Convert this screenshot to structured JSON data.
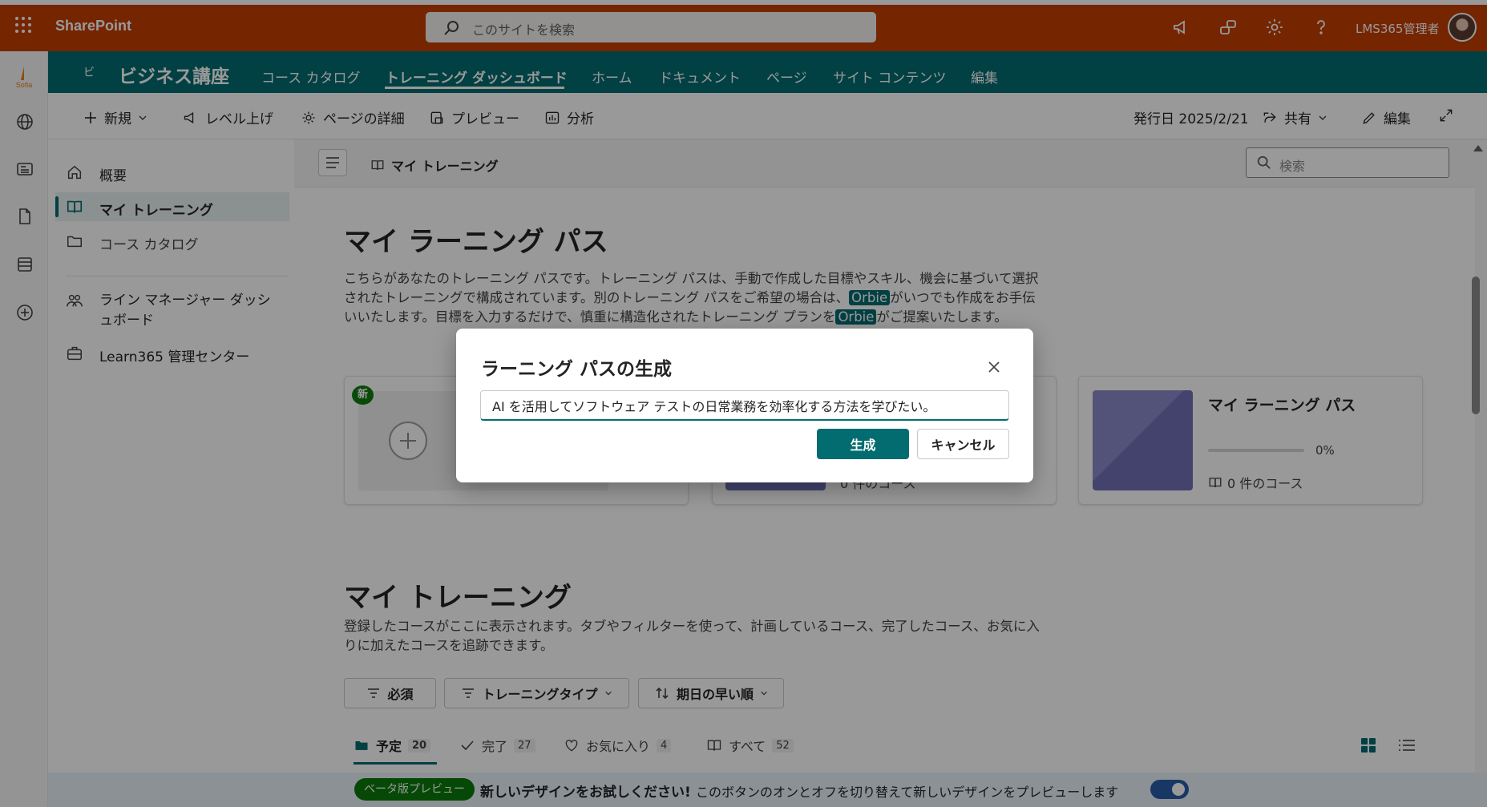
{
  "app": {
    "brand": "SharePoint",
    "search_placeholder": "このサイトを検索",
    "admin_name": "LMS365管理者",
    "icons": [
      "waffle-icon",
      "search-icon",
      "megaphone-icon",
      "chat-icon",
      "gear-icon",
      "help-icon"
    ]
  },
  "rail": {
    "logo_text": "Sofia",
    "icons": [
      "globe-icon",
      "news-icon",
      "document-icon",
      "list-icon",
      "add-icon"
    ]
  },
  "site": {
    "logo_text": "ビ",
    "title": "ビジネス講座",
    "nav": [
      {
        "label": "コース カタログ",
        "active": false
      },
      {
        "label": "トレーニング ダッシュボード",
        "active": true
      },
      {
        "label": "ホーム",
        "active": false
      },
      {
        "label": "ドキュメント",
        "active": false
      },
      {
        "label": "ページ",
        "active": false
      },
      {
        "label": "サイト コンテンツ",
        "active": false
      },
      {
        "label": "編集",
        "active": false
      }
    ],
    "accent_color": "#036c70"
  },
  "commandbar": {
    "new": "新規",
    "promote": "レベル上げ",
    "page_details": "ページの詳細",
    "preview": "プレビュー",
    "analytics": "分析",
    "published": "発行日 2025/2/21",
    "share": "共有",
    "edit": "編集"
  },
  "leftnav": {
    "items": [
      {
        "label": "概要",
        "icon": "home-icon"
      },
      {
        "label": "マイ トレーニング",
        "icon": "book-icon",
        "active": true
      },
      {
        "label": "コース カタログ",
        "icon": "folder-icon"
      },
      {
        "label": "ライン マネージャー ダッシュボード",
        "icon": "people-icon"
      },
      {
        "label": "Learn365 管理センター",
        "icon": "briefcase-icon"
      }
    ]
  },
  "content": {
    "breadcrumb": "マイ トレーニング",
    "search_placeholder": "検索",
    "learning_path": {
      "title": "マイ ラーニング パス",
      "desc_1": "こちらがあなたのトレーニング パスです。トレーニング パスは、手動で作成した目標やスキル、機会に基づいて選択されたトレーニングで構成されています。別のトレーニング パスをご希望の場合は、",
      "orbie": "Orbie",
      "desc_2": "がいつでも作成をお手伝いいたします。目標を入力するだけで、慎重に構造化されたトレーニング プランを",
      "desc_3": "がご提案いたします。",
      "new_badge": "新",
      "card3_title": "マイ ラーニング パス",
      "card3_progress": "0%",
      "card3_progress_value": 0,
      "card3_courses": "0 件のコース",
      "card2_courses": "0 件のコース"
    },
    "my_training": {
      "title": "マイ トレーニング",
      "desc": "登録したコースがここに表示されます。タブやフィルターを使って、計画しているコース、完了したコース、お気に入りに加えたコースを追跡できます。",
      "filters": [
        "必須",
        "トレーニングタイプ",
        "期日の早い順"
      ],
      "tabs": [
        {
          "label": "予定",
          "count": "20",
          "active": true
        },
        {
          "label": "完了",
          "count": "27"
        },
        {
          "label": "お気に入り",
          "count": "4"
        },
        {
          "label": "すべて",
          "count": "52"
        }
      ]
    }
  },
  "beta": {
    "pill": "ベータ版プレビュー",
    "strong": "新しいデザインをお試しください!",
    "text": "このボタンのオンとオフを切り替えて新しいデザインをプレビューします",
    "toggle_on": true
  },
  "dialog": {
    "title": "ラーニング パスの生成",
    "input_value": "AI を活用してソフトウェア テストの日常業務を効率化する方法を学びたい。",
    "generate": "生成",
    "cancel": "キャンセル"
  }
}
